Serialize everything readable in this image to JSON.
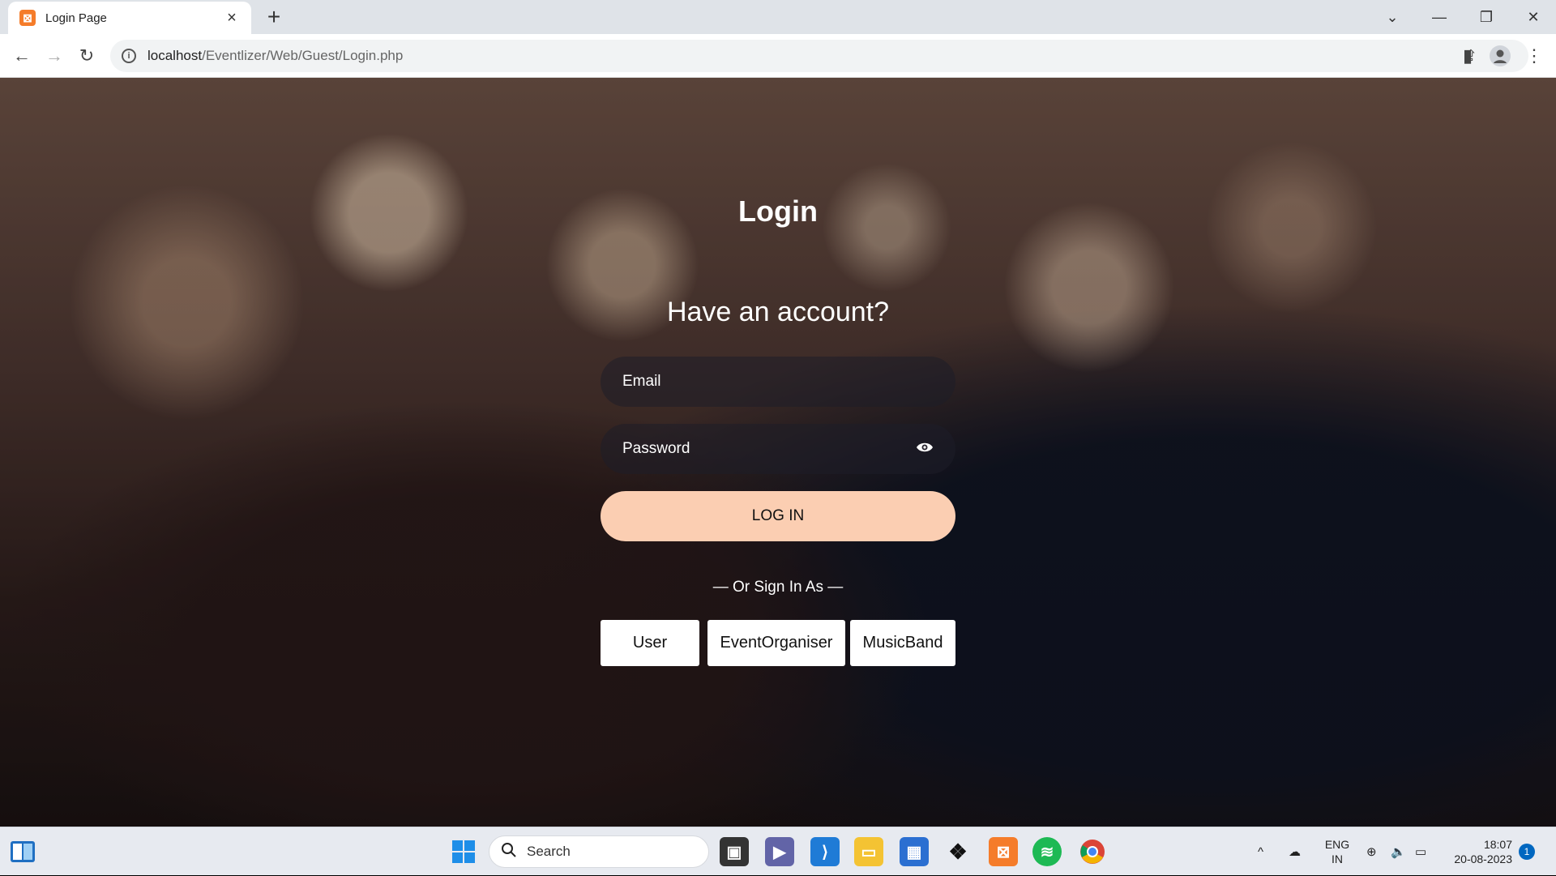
{
  "browser": {
    "tab_title": "Login Page",
    "tab_close": "×",
    "new_tab": "+",
    "url_host": "localhost",
    "url_path": "/Eventlizer/Web/Guest/Login.php"
  },
  "page": {
    "title": "Login",
    "subtitle": "Have an account?",
    "email_placeholder": "Email",
    "password_placeholder": "Password",
    "login_button": "LOG IN",
    "or_sign_in_as": "— Or Sign In As —",
    "roles": [
      "User",
      "EventOrganiser",
      "MusicBand"
    ]
  },
  "taskbar": {
    "search_label": "Search",
    "lang_top": "ENG",
    "lang_bottom": "IN",
    "time": "18:07",
    "date": "20-08-2023",
    "notifications": "1"
  },
  "colors": {
    "login_button": "#fbceb2",
    "field_bg": "rgba(30,30,40,0.55)",
    "favicon": "#f57c2a"
  }
}
